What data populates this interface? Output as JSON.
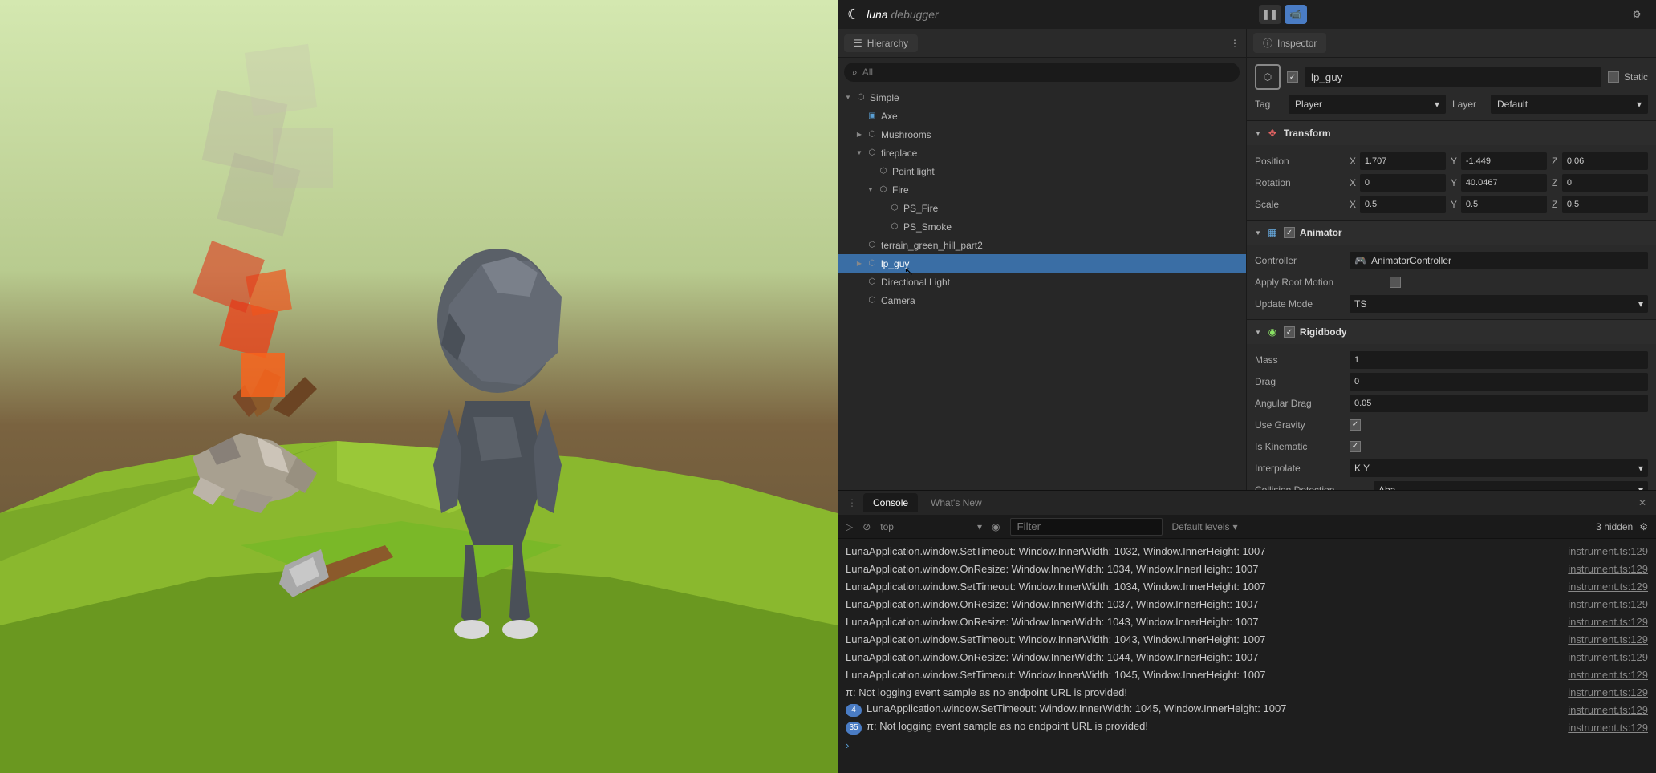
{
  "app": {
    "name": "luna",
    "subtitle": "debugger"
  },
  "hierarchy": {
    "title": "Hierarchy",
    "search_placeholder": "All",
    "root": "Simple",
    "items": {
      "axe": "Axe",
      "mushrooms": "Mushrooms",
      "fireplace": "fireplace",
      "pointlight": "Point light",
      "fire": "Fire",
      "psfire": "PS_Fire",
      "pssmoke": "PS_Smoke",
      "terrain": "terrain_green_hill_part2",
      "lpguy": "lp_guy",
      "dirlight": "Directional Light",
      "camera": "Camera"
    }
  },
  "inspector": {
    "title": "Inspector",
    "name": "lp_guy",
    "static_label": "Static",
    "tag_label": "Tag",
    "tag_value": "Player",
    "layer_label": "Layer",
    "layer_value": "Default",
    "transform": {
      "title": "Transform",
      "position_label": "Position",
      "rotation_label": "Rotation",
      "scale_label": "Scale",
      "pos": {
        "x": "1.707",
        "y": "-1.449",
        "z": "0.06"
      },
      "rot": {
        "x": "0",
        "y": "40.0467",
        "z": "0"
      },
      "scl": {
        "x": "0.5",
        "y": "0.5",
        "z": "0.5"
      }
    },
    "animator": {
      "title": "Animator",
      "controller_label": "Controller",
      "controller_value": "AnimatorController",
      "apply_root_label": "Apply Root Motion",
      "update_mode_label": "Update Mode",
      "update_mode_value": "TS"
    },
    "rigidbody": {
      "title": "Rigidbody",
      "mass_label": "Mass",
      "mass": "1",
      "drag_label": "Drag",
      "drag": "0",
      "angdrag_label": "Angular Drag",
      "angdrag": "0.05",
      "gravity_label": "Use Gravity",
      "kinematic_label": "Is Kinematic",
      "interpolate_label": "Interpolate",
      "interpolate": "K Y",
      "collision_label": "Collision Detection",
      "collision": "Aba"
    }
  },
  "console": {
    "tab_console": "Console",
    "tab_whatsnew": "What's New",
    "context": "top",
    "levels": "Default levels",
    "filter_placeholder": "Filter",
    "hidden": "3 hidden",
    "source": "instrument.ts:129",
    "lines": [
      "LunaApplication.window.SetTimeout: Window.InnerWidth: 1032, Window.InnerHeight: 1007",
      "LunaApplication.window.OnResize: Window.InnerWidth: 1034, Window.InnerHeight: 1007",
      "LunaApplication.window.SetTimeout: Window.InnerWidth: 1034, Window.InnerHeight: 1007",
      "LunaApplication.window.OnResize: Window.InnerWidth: 1037, Window.InnerHeight: 1007",
      "LunaApplication.window.OnResize: Window.InnerWidth: 1043, Window.InnerHeight: 1007",
      "LunaApplication.window.SetTimeout: Window.InnerWidth: 1043, Window.InnerHeight: 1007",
      "LunaApplication.window.OnResize: Window.InnerWidth: 1044, Window.InnerHeight: 1007",
      "LunaApplication.window.SetTimeout: Window.InnerWidth: 1045, Window.InnerHeight: 1007",
      "π: Not logging event sample as no endpoint URL is provided!"
    ],
    "badge4_line": "LunaApplication.window.SetTimeout: Window.InnerWidth: 1045, Window.InnerHeight: 1007",
    "badge35_line": "π: Not logging event sample as no endpoint URL is provided!"
  }
}
